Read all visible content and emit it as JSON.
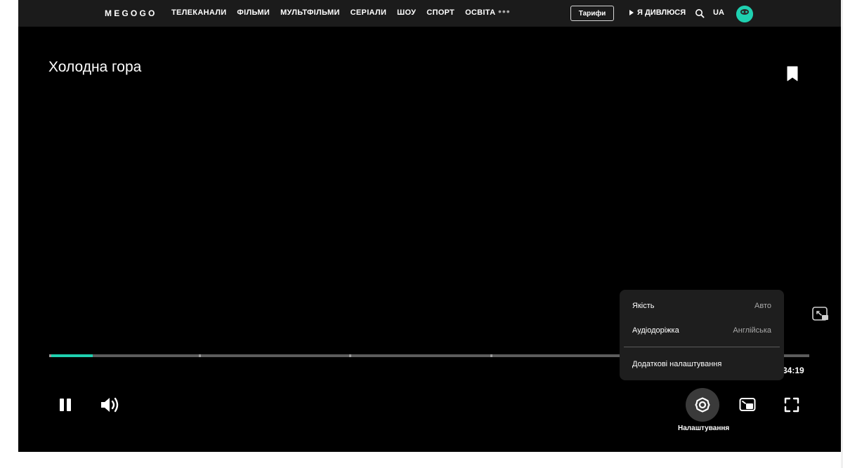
{
  "nav": {
    "logo": "MEGOGO",
    "items": [
      "ТЕЛЕКАНАЛИ",
      "ФІЛЬМИ",
      "МУЛЬТФІЛЬМИ",
      "СЕРІАЛИ",
      "ШОУ",
      "СПОРТ",
      "ОСВІТА"
    ],
    "more_icon": "more-dots-icon",
    "tariffs_label": "Тарифи",
    "watching_label": "Я ДИВЛЮСЯ",
    "language": "UA"
  },
  "player": {
    "title": "Холодна гора",
    "time": ":34:19",
    "progress": 0.057,
    "chapter_marks": [
      0.197,
      0.395,
      0.58
    ],
    "settings_label": "Налаштування"
  },
  "settings_menu": {
    "quality_label": "Якість",
    "quality_value": "Авто",
    "audio_label": "Аудіодоріжка",
    "audio_value": "Англійська",
    "advanced_label": "Додаткові налаштування"
  },
  "colors": {
    "accent": "#1fd0b0",
    "background": "#000000",
    "nav_bg": "#1b1b1b",
    "menu_bg": "#1e1e1e"
  }
}
